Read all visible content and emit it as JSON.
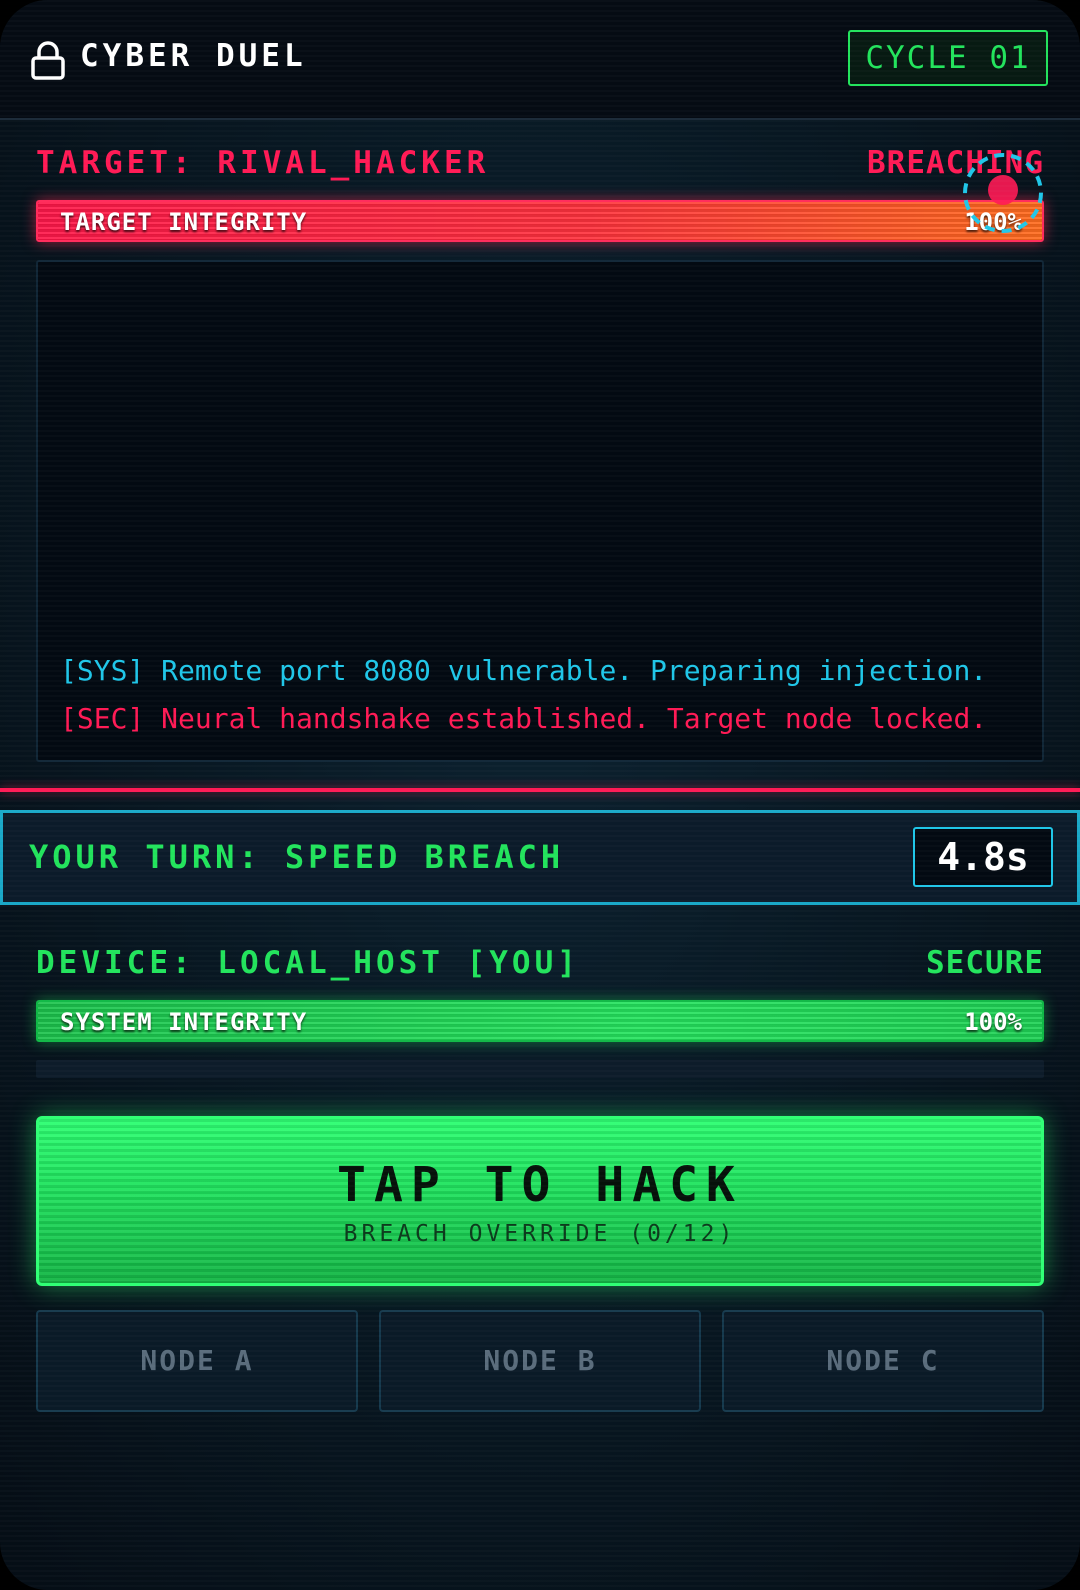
{
  "header": {
    "title": "CYBER DUEL",
    "cycle": "CYCLE 01",
    "lock_icon": "lock-icon"
  },
  "opponent": {
    "label": "TARGET: RIVAL_HACKER",
    "status": "BREACHING",
    "integrity_label": "TARGET INTEGRITY",
    "integrity_value": "100%",
    "integrity_level": 100
  },
  "log": {
    "lines": [
      {
        "type": "SYS",
        "text": "[SYS] Remote port 8080 vulnerable. Preparing injection."
      },
      {
        "type": "SEC",
        "text": "[SEC] Neural handshake established. Target node locked."
      }
    ]
  },
  "turn": {
    "text": "YOUR TURN: SPEED BREACH",
    "timer": "4.8s"
  },
  "player": {
    "label": "DEVICE: LOCAL_HOST [YOU]",
    "status": "SECURE",
    "integrity_label": "SYSTEM INTEGRITY",
    "integrity_value": "100%",
    "integrity_level": 100
  },
  "action": {
    "title": "TAP TO HACK",
    "subtitle": "BREACH OVERRIDE (0/12)"
  },
  "nodes": [
    {
      "label": "NODE A"
    },
    {
      "label": "NODE B"
    },
    {
      "label": "NODE C"
    }
  ],
  "colors": {
    "enemy": "#ff1a55",
    "player": "#22e35c",
    "info": "#1fc6e8",
    "background": "#081823"
  }
}
